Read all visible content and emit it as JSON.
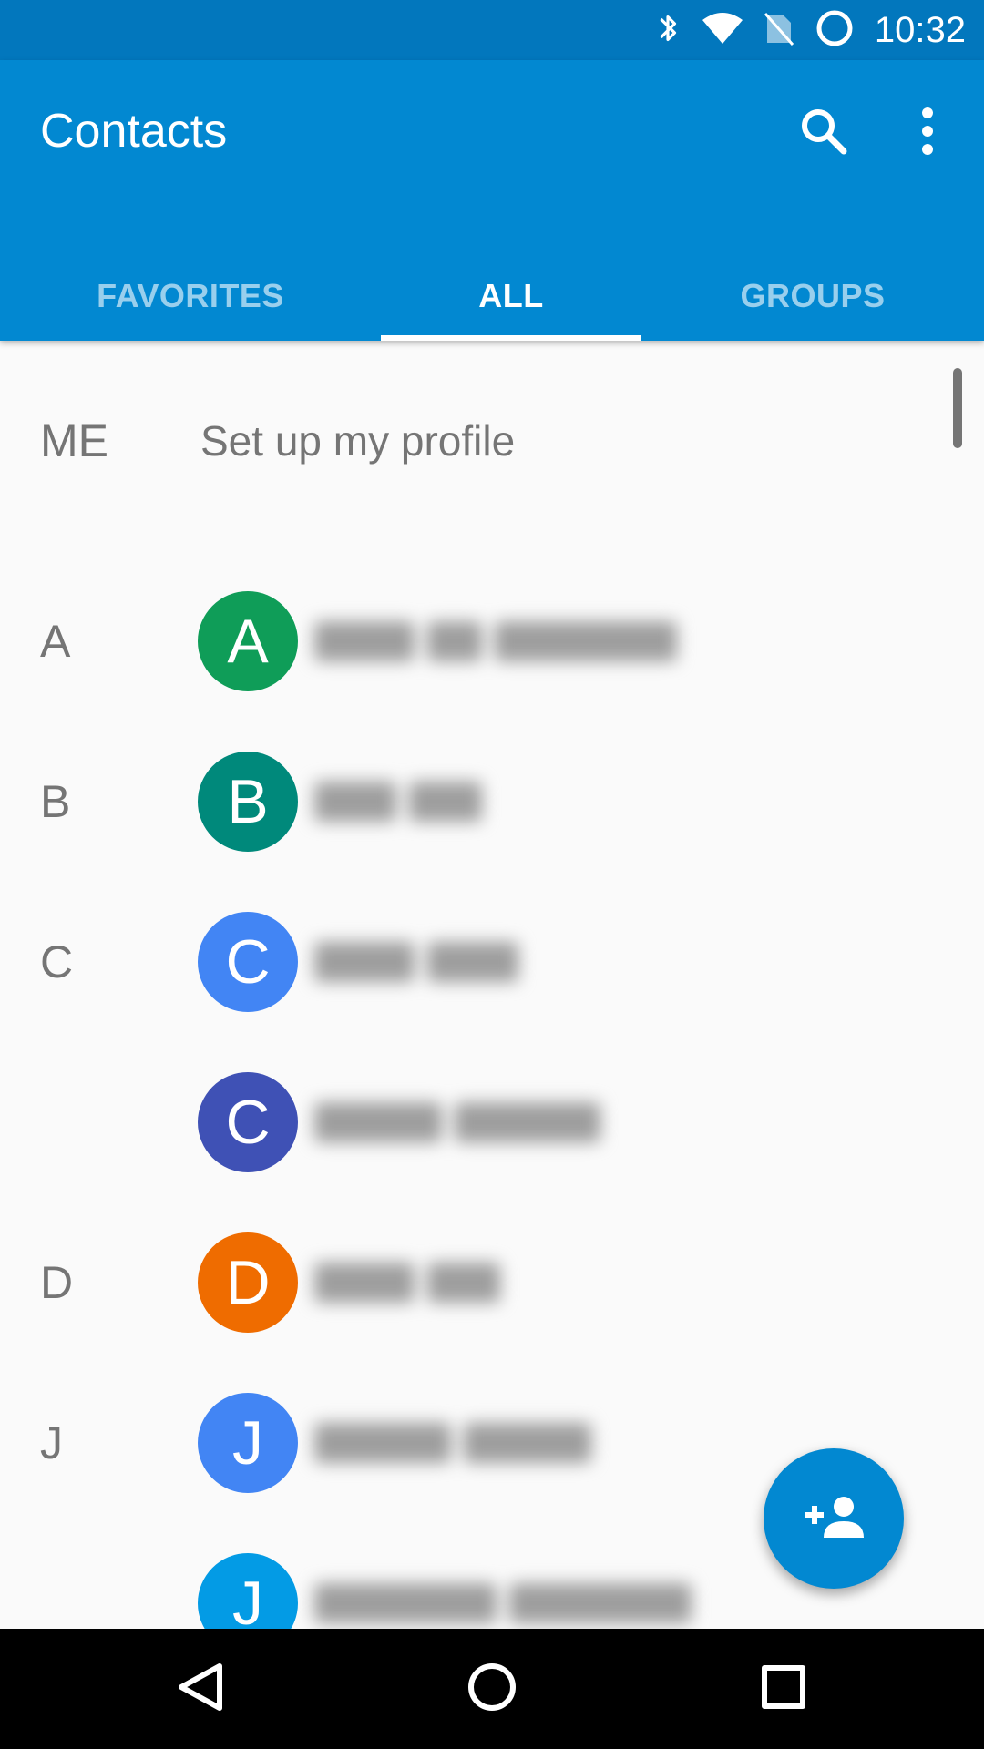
{
  "status_bar": {
    "time": "10:32",
    "icons": [
      "bluetooth-icon",
      "wifi-icon",
      "no-sim-icon",
      "battery-charging-icon"
    ]
  },
  "app_bar": {
    "title": "Contacts",
    "actions": [
      "search-icon",
      "more-vert-icon"
    ],
    "color": "#0288d1"
  },
  "tabs": [
    {
      "label": "FAVORITES",
      "active": false
    },
    {
      "label": "ALL",
      "active": true
    },
    {
      "label": "GROUPS",
      "active": false
    }
  ],
  "profile": {
    "label": "ME",
    "text": "Set up my profile"
  },
  "contacts": [
    {
      "section": "A",
      "initial": "A",
      "color": "#0f9d58"
    },
    {
      "section": "B",
      "initial": "B",
      "color": "#00897b"
    },
    {
      "section": "C",
      "initial": "C",
      "color": "#4285f4"
    },
    {
      "section": "",
      "initial": "C",
      "color": "#3f51b5"
    },
    {
      "section": "D",
      "initial": "D",
      "color": "#ef6c00"
    },
    {
      "section": "J",
      "initial": "J",
      "color": "#4285f4"
    },
    {
      "section": "",
      "initial": "J",
      "color": "#039be5"
    }
  ],
  "fab": {
    "icon": "person-add-icon",
    "color": "#0288d1"
  },
  "nav_bar": {
    "buttons": [
      "back-icon",
      "home-icon",
      "recents-icon"
    ]
  }
}
